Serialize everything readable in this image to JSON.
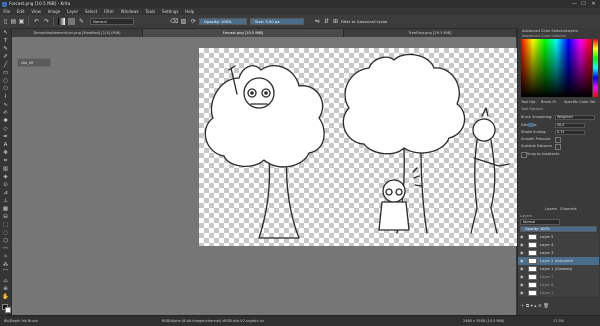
{
  "window": {
    "title": "Forcast.png [10.5 MiB] - Krita",
    "min": "—",
    "max": "☐",
    "close": "✕"
  },
  "menubar": [
    "File",
    "Edit",
    "View",
    "Image",
    "Layer",
    "Select",
    "Filter",
    "Windows",
    "Tools",
    "Settings",
    "Help"
  ],
  "toolbar": {
    "blend_mode": "Normal",
    "opacity": "Opacity: 100%",
    "size": "Size: 3.00 px",
    "wrap_label": "Filter to GaussianCrystal"
  },
  "tabs": [
    {
      "label": "Dementia/dementium.png [Modified] [1/3] (MiB)",
      "active": false
    },
    {
      "label": "Forcast.png [10.5 MiB]",
      "active": true
    },
    {
      "label": "TreeFlow.png [29.3 MiB]",
      "active": false
    }
  ],
  "popup": {
    "label": "cbb_eff"
  },
  "dock": {
    "color_tabs": [
      "Advanced Color Selector",
      "Layers"
    ],
    "color_header": "Advanced Color Selector",
    "tool_tabs": [
      "Tool Opt.",
      "Brush Pr.",
      "Specific Color Sel."
    ],
    "tool_header": "Tool Options",
    "options": [
      {
        "label": "Brush Smoothing:",
        "value": "Weighted"
      },
      {
        "label": "Distance:",
        "value": "50.0"
      },
      {
        "label": "Stroke Ending:",
        "value": "0.15"
      },
      {
        "label": "Smooth Pressure",
        "value": ""
      },
      {
        "label": "Scalable Distance",
        "value": ""
      },
      {
        "label": "Snap to Assistants",
        "value": ""
      }
    ],
    "layers_tabs": [
      "Layers",
      "Channels"
    ],
    "layers_header": "Layers",
    "layer_mode": "Normal",
    "layer_opacity": "Opacity: 100%",
    "layers": [
      {
        "name": "Layer 5",
        "selected": false
      },
      {
        "name": "Layer 4",
        "selected": false
      },
      {
        "name": "Layer 3",
        "selected": false
      },
      {
        "name": "Layer 2 (Adjusted)",
        "selected": true
      },
      {
        "name": "Layer 1 (Cleaned)",
        "selected": false
      },
      {
        "name": "Layer 7",
        "selected": false
      },
      {
        "name": "Layer 6",
        "selected": false
      },
      {
        "name": "Layer 1",
        "selected": false
      }
    ]
  },
  "statusbar": {
    "left": "Bb/Depth Ink Brush",
    "center": "RGB/Alpha (8-bit integer/channel)  sRGB-elle-V2-srgbtrc.icc",
    "right": "2480 x 3508 (10.5 MiB)",
    "zoom": "17.5%"
  },
  "icons": {
    "toolbar": [
      "new-file-icon",
      "open-icon",
      "save-icon",
      "undo-icon",
      "redo-icon",
      "gradient-icon",
      "pattern-icon",
      "brush-preset-icon",
      "eraser-icon",
      "alpha-lock-icon",
      "mirror-h-icon",
      "mirror-v-icon",
      "wrap-icon"
    ],
    "toolbox": [
      "select-icon",
      "transform-icon",
      "brush-icon",
      "freehand-icon",
      "line-icon",
      "rect-icon",
      "ellipse-icon",
      "polygon-icon",
      "polyline-icon",
      "bezier-icon",
      "dynamic-brush-icon",
      "multibrush-icon",
      "shape-edit-icon",
      "calligraphy-icon",
      "text-icon",
      "move-icon",
      "crop-icon",
      "gradient-fill-icon",
      "pattern-icon",
      "fill-icon",
      "colorpicker-icon",
      "assistant-icon",
      "measure-icon",
      "reference-icon",
      "rect-select-icon",
      "ellipse-select-icon",
      "poly-select-icon",
      "freehand-select-icon",
      "contiguous-select-icon",
      "similar-select-icon",
      "bezier-select-icon",
      "magnetic-select-icon",
      "zoom-icon",
      "pan-icon"
    ]
  }
}
